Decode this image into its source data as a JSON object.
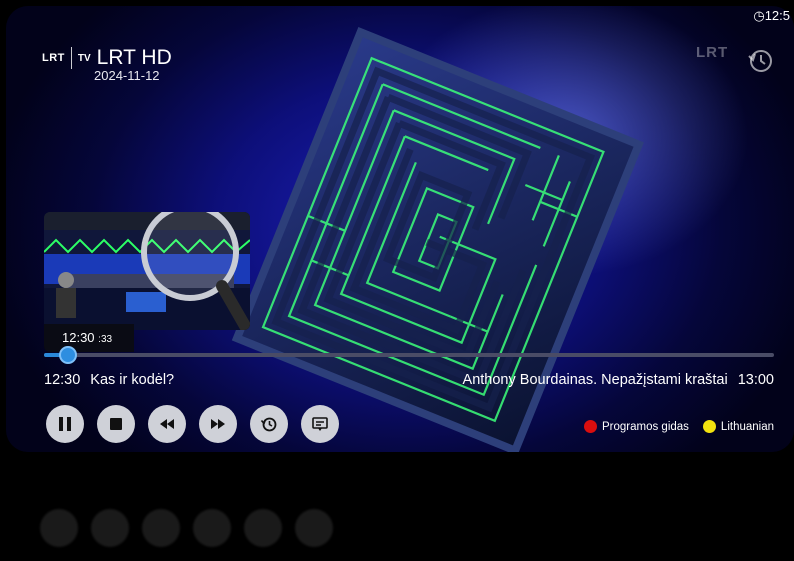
{
  "status": {
    "clock": "12:5"
  },
  "channel": {
    "logo": "LRT",
    "tv": "TV",
    "name": "LRT HD",
    "date": "2024-11-12"
  },
  "corner_logo": "LRT",
  "preview": {
    "time": "12:30",
    "seconds": ":33"
  },
  "progress": {
    "fraction": 0.033
  },
  "now": {
    "time": "12:30",
    "title": "Kas ir kodėl?"
  },
  "next": {
    "title": "Anthony Bourdainas. Nepažįstami kraštai",
    "time": "13:00"
  },
  "controls": [
    "pause-icon",
    "stop-icon",
    "rewind-icon",
    "fast-forward-icon",
    "history-icon",
    "subtitles-icon"
  ],
  "legend": [
    {
      "label": "Programos gidas",
      "color": "#d90e0e"
    },
    {
      "label": "Lithuanian",
      "color": "#f2e20f"
    }
  ],
  "colors": {
    "accent": "#2e8ee0",
    "maze_glow": "#3cff7a"
  }
}
